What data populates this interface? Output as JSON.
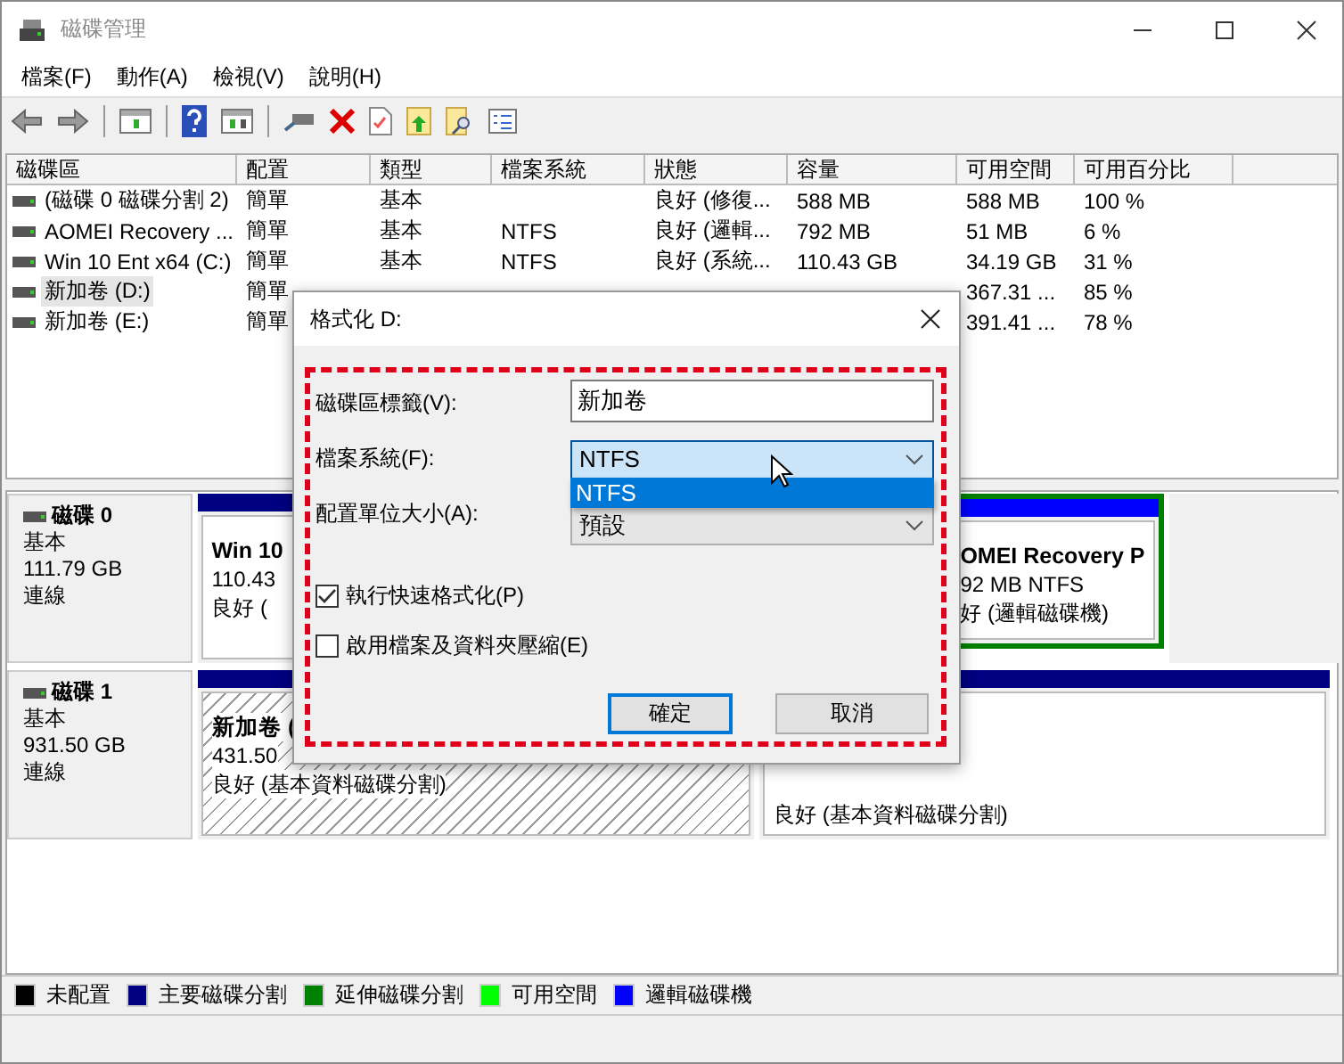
{
  "window": {
    "title": "磁碟管理"
  },
  "menu": [
    "檔案(F)",
    "動作(A)",
    "檢視(V)",
    "說明(H)"
  ],
  "volume_table": {
    "columns": [
      "磁碟區",
      "配置",
      "類型",
      "檔案系統",
      "狀態",
      "容量",
      "可用空間",
      "可用百分比"
    ],
    "rows": [
      {
        "selected": false,
        "volume": "(磁碟 0 磁碟分割 2)",
        "layout": "簡單",
        "type": "基本",
        "status": "良好 (修復...",
        "capacity": "588 MB",
        "free_space": "588 MB",
        "free_percent": "100 %"
      },
      {
        "selected": false,
        "volume": "AOMEI Recovery ...",
        "layout": "簡單",
        "type": "基本",
        "file_system": "NTFS",
        "status": "良好 (邏輯...",
        "capacity": "792 MB",
        "free_space": "51 MB",
        "free_percent": "6 %"
      },
      {
        "selected": false,
        "volume": "Win 10 Ent x64 (C:)",
        "layout": "簡單",
        "type": "基本",
        "file_system": "NTFS",
        "status": "良好 (系統...",
        "capacity": "110.43 GB",
        "free_space": "34.19 GB",
        "free_percent": "31 %"
      },
      {
        "selected": true,
        "volume": "新加卷 (D:)",
        "layout": "簡單",
        "free_space": "367.31 ...",
        "free_percent": "85 %"
      },
      {
        "selected": false,
        "volume": "新加卷 (E:)",
        "layout": "簡單",
        "free_space": "391.41 ...",
        "free_percent": "78 %"
      }
    ]
  },
  "disks": [
    {
      "name": "磁碟 0",
      "type": "基本",
      "size": "111.79 GB",
      "status": "連線",
      "partitions": [
        {
          "kind": "primary",
          "selected": false,
          "lines": [
            "Win 10",
            "110.43",
            "良好 ("
          ]
        },
        {
          "kind": "logical",
          "selected": false,
          "lines": [
            "OMEI Recovery P",
            "92 MB NTFS",
            "好 (邏輯磁碟機)"
          ]
        }
      ]
    },
    {
      "name": "磁碟 1",
      "type": "基本",
      "size": "931.50 GB",
      "status": "連線",
      "partitions": [
        {
          "kind": "primary",
          "selected": true,
          "lines": [
            "新加卷 (",
            "431.50",
            "良好 (基本資料磁碟分割)"
          ]
        },
        {
          "kind": "primary",
          "selected": false,
          "lines": [
            "良好 (基本資料磁碟分割)"
          ]
        }
      ]
    }
  ],
  "legend": [
    {
      "label": "未配置",
      "color": "#000000"
    },
    {
      "label": "主要磁碟分割",
      "color": "#000080"
    },
    {
      "label": "延伸磁碟分割",
      "color": "#008000"
    },
    {
      "label": "可用空間",
      "color": "#00ff00"
    },
    {
      "label": "邏輯磁碟機",
      "color": "#0000ff"
    }
  ],
  "dialog": {
    "title": "格式化 D:",
    "volume_label": {
      "label": "磁碟區標籤(V):",
      "value": "新加卷"
    },
    "file_system": {
      "label": "檔案系統(F):",
      "value": "NTFS",
      "expanded": true,
      "options": [
        {
          "label": "NTFS",
          "selected": true
        }
      ]
    },
    "allocation_unit": {
      "label": "配置單位大小(A):",
      "value": "預設"
    },
    "options": [
      {
        "label": "執行快速格式化(P)",
        "checked": true
      },
      {
        "label": "啟用檔案及資料夾壓縮(E)",
        "checked": false
      }
    ],
    "buttons": [
      {
        "label": "確定",
        "default": true
      },
      {
        "label": "取消",
        "default": false
      }
    ]
  }
}
